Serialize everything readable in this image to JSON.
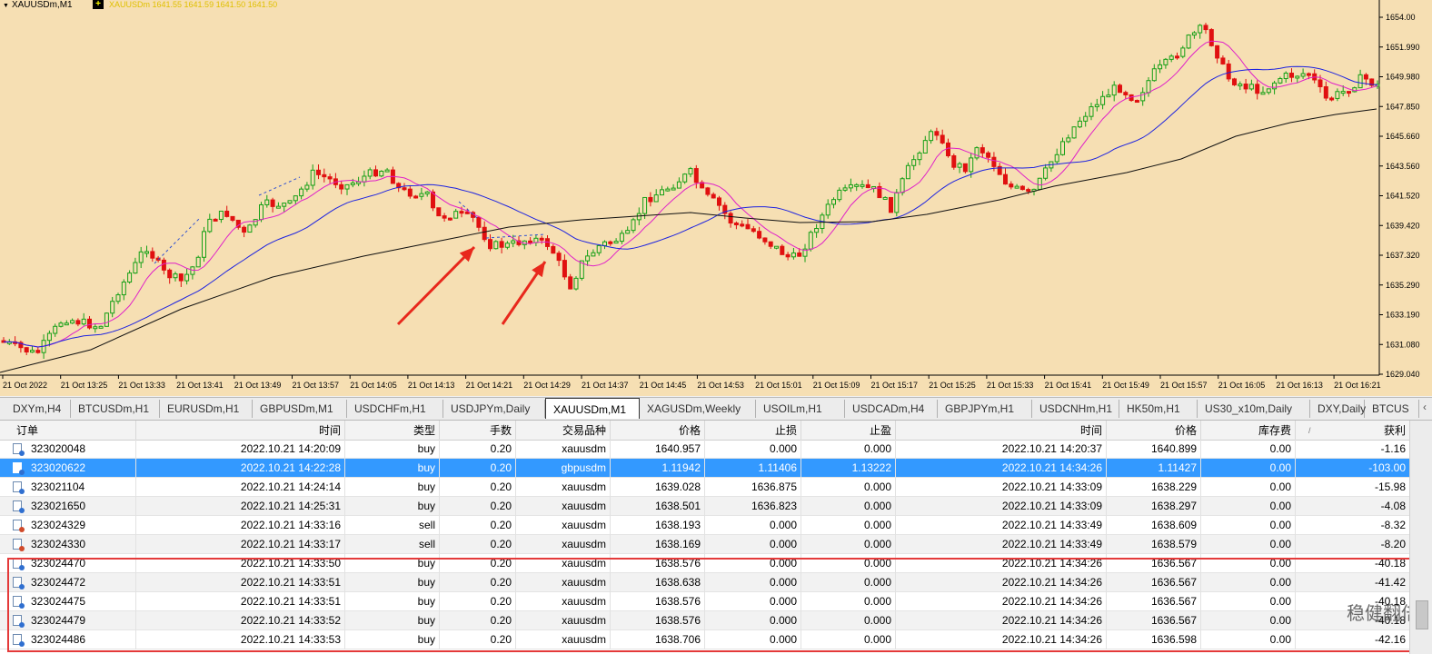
{
  "chart": {
    "title": "XAUUSDm,M1",
    "badge": "+",
    "ticker_text": "XAUUSDm  1641.55 1641.59 1641.50 1641.50",
    "y_labels": [
      "1654.00",
      "1651.990",
      "1649.980",
      "1647.850",
      "1645.660",
      "1643.560",
      "1641.520",
      "1639.420",
      "1637.320",
      "1635.290",
      "1633.190",
      "1631.080",
      "1629.040"
    ],
    "x_labels": [
      "21 Oct 2022",
      "21 Oct 13:25",
      "21 Oct 13:33",
      "21 Oct 13:41",
      "21 Oct 13:49",
      "21 Oct 13:57",
      "21 Oct 14:05",
      "21 Oct 14:13",
      "21 Oct 14:21",
      "21 Oct 14:29",
      "21 Oct 14:37",
      "21 Oct 14:45",
      "21 Oct 14:53",
      "21 Oct 15:01",
      "21 Oct 15:09",
      "21 Oct 15:17",
      "21 Oct 15:25",
      "21 Oct 15:33",
      "21 Oct 15:41",
      "21 Oct 15:49",
      "21 Oct 15:57",
      "21 Oct 16:05",
      "21 Oct 16:13",
      "21 Oct 16:21"
    ],
    "colors": {
      "bg": "#f6dfb3",
      "bull": "#16a016",
      "bear": "#e01010",
      "ma_fast": "#e020c8",
      "ma_mid": "#1c22e0",
      "ma_slow": "#101010",
      "arrow": "#e8281c"
    }
  },
  "tabs": [
    {
      "label": "DXYm,H4"
    },
    {
      "label": "BTCUSDm,H1"
    },
    {
      "label": "EURUSDm,H1"
    },
    {
      "label": "GBPUSDm,M1"
    },
    {
      "label": "USDCHFm,H1"
    },
    {
      "label": "USDJPYm,Daily"
    },
    {
      "label": "XAUUSDm,M1"
    },
    {
      "label": "XAGUSDm,Weekly"
    },
    {
      "label": "USOILm,H1"
    },
    {
      "label": "USDCADm,H4"
    },
    {
      "label": "GBPJPYm,H1"
    },
    {
      "label": "USDCNHm,H1"
    },
    {
      "label": "HK50m,H1"
    },
    {
      "label": "US30_x10m,Daily"
    },
    {
      "label": "DXY,Daily"
    },
    {
      "label": "BTCUS"
    }
  ],
  "tab_more": "‹",
  "table": {
    "headers": [
      "订单",
      "时间",
      "类型",
      "手数",
      "交易品种",
      "价格",
      "止损",
      "止盈",
      "时间",
      "价格",
      "库存费",
      "获利"
    ],
    "sort_mark": "/",
    "rows": [
      [
        "323020048",
        "2022.10.21 14:20:09",
        "buy",
        "0.20",
        "xauusdm",
        "1640.957",
        "0.000",
        "0.000",
        "2022.10.21 14:20:37",
        "1640.899",
        "0.00",
        "-1.16"
      ],
      [
        "323020622",
        "2022.10.21 14:22:28",
        "buy",
        "0.20",
        "gbpusdm",
        "1.11942",
        "1.11406",
        "1.13222",
        "2022.10.21 14:34:26",
        "1.11427",
        "0.00",
        "-103.00"
      ],
      [
        "323021104",
        "2022.10.21 14:24:14",
        "buy",
        "0.20",
        "xauusdm",
        "1639.028",
        "1636.875",
        "0.000",
        "2022.10.21 14:33:09",
        "1638.229",
        "0.00",
        "-15.98"
      ],
      [
        "323021650",
        "2022.10.21 14:25:31",
        "buy",
        "0.20",
        "xauusdm",
        "1638.501",
        "1636.823",
        "0.000",
        "2022.10.21 14:33:09",
        "1638.297",
        "0.00",
        "-4.08"
      ],
      [
        "323024329",
        "2022.10.21 14:33:16",
        "sell",
        "0.20",
        "xauusdm",
        "1638.193",
        "0.000",
        "0.000",
        "2022.10.21 14:33:49",
        "1638.609",
        "0.00",
        "-8.32"
      ],
      [
        "323024330",
        "2022.10.21 14:33:17",
        "sell",
        "0.20",
        "xauusdm",
        "1638.169",
        "0.000",
        "0.000",
        "2022.10.21 14:33:49",
        "1638.579",
        "0.00",
        "-8.20"
      ],
      [
        "323024470",
        "2022.10.21 14:33:50",
        "buy",
        "0.20",
        "xauusdm",
        "1638.576",
        "0.000",
        "0.000",
        "2022.10.21 14:34:26",
        "1636.567",
        "0.00",
        "-40.18"
      ],
      [
        "323024472",
        "2022.10.21 14:33:51",
        "buy",
        "0.20",
        "xauusdm",
        "1638.638",
        "0.000",
        "0.000",
        "2022.10.21 14:34:26",
        "1636.567",
        "0.00",
        "-41.42"
      ],
      [
        "323024475",
        "2022.10.21 14:33:51",
        "buy",
        "0.20",
        "xauusdm",
        "1638.576",
        "0.000",
        "0.000",
        "2022.10.21 14:34:26",
        "1636.567",
        "0.00",
        "-40.18"
      ],
      [
        "323024479",
        "2022.10.21 14:33:52",
        "buy",
        "0.20",
        "xauusdm",
        "1638.576",
        "0.000",
        "0.000",
        "2022.10.21 14:34:26",
        "1636.567",
        "0.00",
        "-40.18"
      ],
      [
        "323024486",
        "2022.10.21 14:33:53",
        "buy",
        "0.20",
        "xauusdm",
        "1638.706",
        "0.000",
        "0.000",
        "2022.10.21 14:34:26",
        "1636.598",
        "0.00",
        "-42.16"
      ]
    ],
    "selected_row": 1
  },
  "watermark": "稳健翻倍"
}
